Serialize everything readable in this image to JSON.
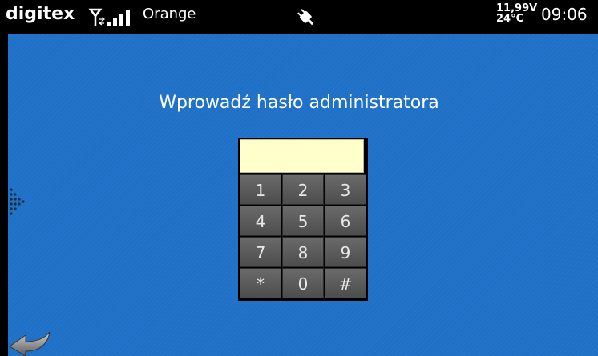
{
  "status_bar": {
    "brand": "digitex",
    "operator": "Orange",
    "voltage": "11,99V",
    "temperature": "24°C",
    "time": "09:06",
    "icons": [
      "signal-strength-icon",
      "power-plug-icon"
    ]
  },
  "login": {
    "prompt": "Wprowadź hasło administratora",
    "password_value": ""
  },
  "keypad": {
    "keys": [
      "1",
      "2",
      "3",
      "4",
      "5",
      "6",
      "7",
      "8",
      "9",
      "*",
      "0",
      "#"
    ]
  },
  "navigation": {
    "icons": [
      "drawer-handle-icon",
      "back-arrow-icon"
    ]
  },
  "colors": {
    "background": "#1f70c7",
    "status_bar": "#000000",
    "input": "#ffffcc",
    "key": "#5a5a5a"
  }
}
